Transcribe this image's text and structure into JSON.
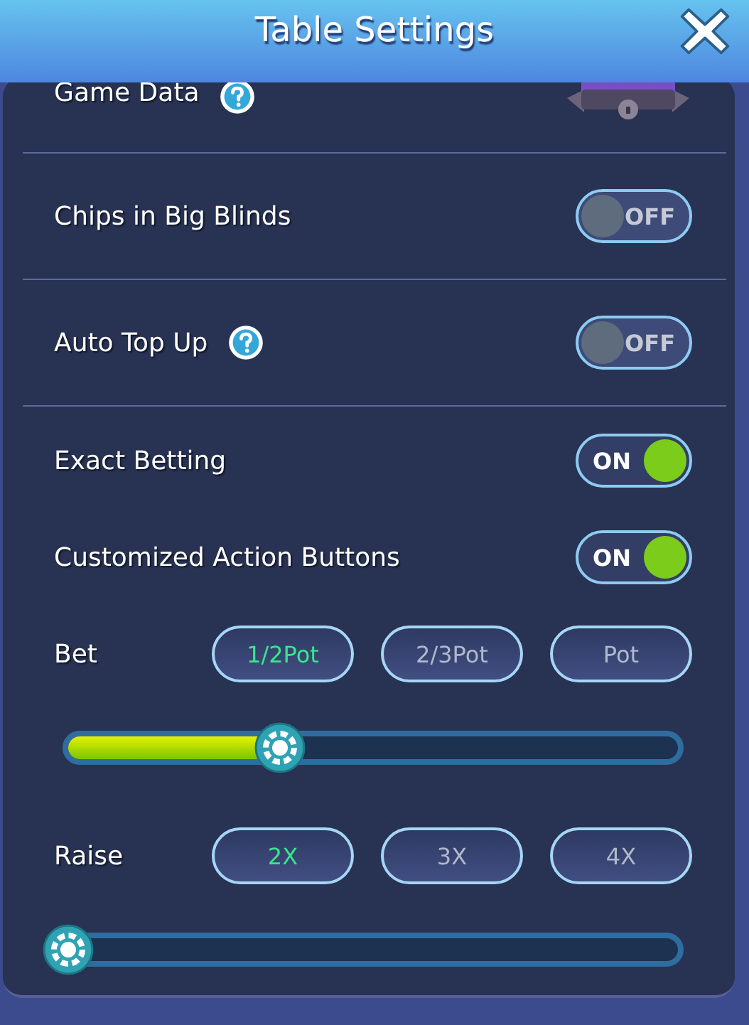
{
  "window": {
    "title": "Table Settings"
  },
  "groups": [
    {
      "rows": [
        {
          "kind": "locked",
          "label": "Game Data",
          "help": true
        }
      ]
    },
    {
      "rows": [
        {
          "kind": "toggle",
          "label": "Chips in Big Blinds",
          "help": false,
          "on": false,
          "state_label": "OFF"
        }
      ]
    },
    {
      "rows": [
        {
          "kind": "toggle",
          "label": "Auto Top Up",
          "help": true,
          "on": false,
          "state_label": "OFF"
        }
      ]
    },
    {
      "rows": [
        {
          "kind": "toggle",
          "label": "Exact Betting",
          "help": false,
          "on": true,
          "state_label": "ON"
        },
        {
          "kind": "toggle",
          "label": "Customized Action Buttons",
          "help": false,
          "on": true,
          "state_label": "ON"
        },
        {
          "kind": "preset",
          "label": "Bet",
          "level": 0.36,
          "options": [
            {
              "label": "1/2Pot",
              "selected": true
            },
            {
              "label": "2/3Pot",
              "selected": false
            },
            {
              "label": "Pot",
              "selected": false
            }
          ]
        },
        {
          "kind": "preset",
          "label": "Raise",
          "level": 0,
          "options": [
            {
              "label": "2X",
              "selected": true
            },
            {
              "label": "3X",
              "selected": false
            },
            {
              "label": "4X",
              "selected": false
            }
          ]
        }
      ]
    }
  ]
}
